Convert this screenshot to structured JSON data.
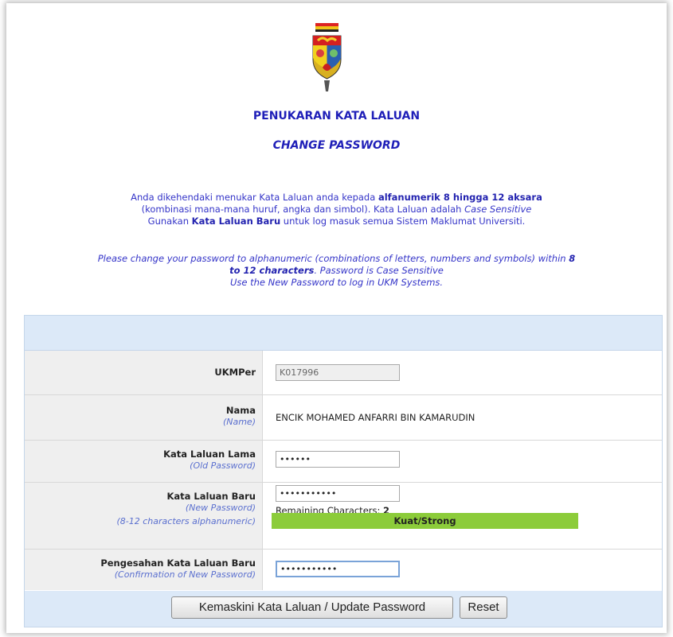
{
  "titles": {
    "ms": "PENUKARAN KATA LALUAN",
    "en": "CHANGE PASSWORD"
  },
  "intro_ms": {
    "line1_a": "Anda dikehendaki menukar Kata Laluan anda kepada ",
    "line1_b": "alfanumerik 8 hingga 12 aksara",
    "line2": "(kombinasi mana-mana huruf, angka dan simbol). Kata Laluan adalah ",
    "line2_b": "Case Sensitive",
    "line3_a": "Gunakan ",
    "line3_b": "Kata Laluan Baru",
    "line3_c": " untuk log masuk semua Sistem Maklumat Universiti."
  },
  "intro_en": {
    "line1_a": "Please change your password to alphanumeric (combinations of letters, numbers and symbols) within ",
    "line1_b": "8",
    "line2_a": "to 12 characters",
    "line2_b": ". Password is Case Sensitive",
    "line3": "Use the New Password to log in UKM Systems."
  },
  "form": {
    "ukmper": {
      "label": "UKMPer",
      "value": "K017996"
    },
    "nama": {
      "label": "Nama",
      "sublabel": "(Name)",
      "value": "ENCIK MOHAMED ANFARRI BIN KAMARUDIN"
    },
    "old_password": {
      "label": "Kata Laluan Lama",
      "sublabel": "(Old Password)",
      "value": "••••••"
    },
    "new_password": {
      "label": "Kata Laluan Baru",
      "sublabel": "(New Password)",
      "value": "•••••••••••",
      "hint": "(8-12 characters alphanumeric)",
      "remaining_label": "Remaining Characters:",
      "remaining_value": "2",
      "strength": "Kuat/Strong",
      "strength_color": "#8ccc3a"
    },
    "confirm_password": {
      "label": "Pengesahan Kata Laluan Baru",
      "sublabel": "(Confirmation of New Password)",
      "value": "•••••••••••"
    },
    "buttons": {
      "update": "Kemaskini Kata Laluan / Update Password",
      "reset": "Reset"
    }
  },
  "colors": {
    "heading": "#1f1fb8",
    "header_band": "#dce9f8"
  },
  "logo": {
    "icon": "university-crest-icon"
  }
}
